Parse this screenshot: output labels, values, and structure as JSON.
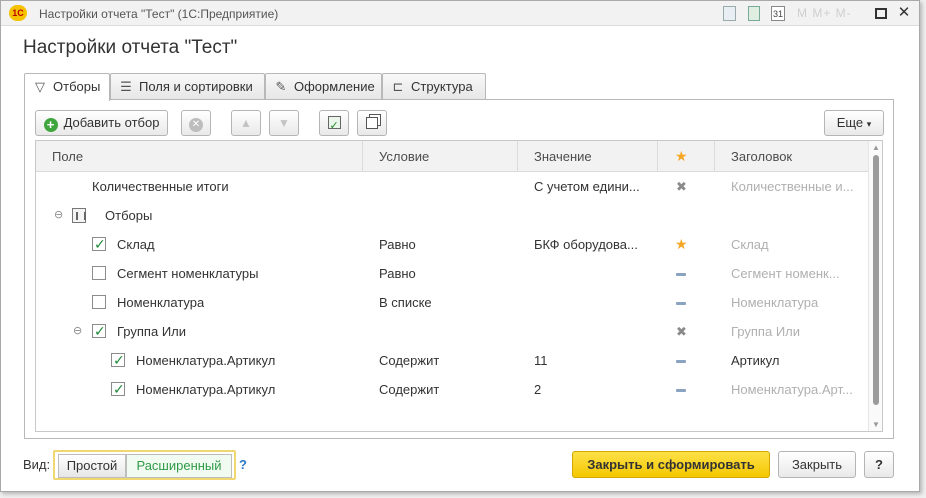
{
  "window": {
    "app_logo": "1С",
    "title": "Настройки отчета \"Тест\" (1С:Предприятие)",
    "titlebar_faint": "М М+ М-",
    "calendar_day": "31"
  },
  "form_title": "Настройки отчета \"Тест\"",
  "tabs": [
    {
      "label": "Отборы",
      "icon": "funnel-icon"
    },
    {
      "label": "Поля и сортировки",
      "icon": "list-icon"
    },
    {
      "label": "Оформление",
      "icon": "brush-icon"
    },
    {
      "label": "Структура",
      "icon": "tree-icon"
    }
  ],
  "toolbar": {
    "add_filter": "Добавить отбор",
    "more": "Еще",
    "more_arrow": "▾"
  },
  "grid": {
    "columns": [
      "Поле",
      "Условие",
      "Значение",
      "★",
      "Заголовок"
    ],
    "rows": [
      {
        "field": "Количественные итоги",
        "condition": "",
        "value": "С учетом едини...",
        "mark": "✖",
        "caption": "Количественные и..."
      },
      {
        "field": "Отборы",
        "condition": "",
        "value": "",
        "mark": "",
        "caption": "",
        "expander": "⊖"
      },
      {
        "field": "Склад",
        "condition": "Равно",
        "value": "БКФ оборудова...",
        "mark": "★",
        "caption": "Склад",
        "checked": true
      },
      {
        "field": "Сегмент номенклатуры",
        "condition": "Равно",
        "value": "",
        "mark": "—",
        "caption": "Сегмент номенк...",
        "checked": false
      },
      {
        "field": "Номенклатура",
        "condition": "В списке",
        "value": "",
        "mark": "—",
        "caption": "Номенклатура",
        "checked": false
      },
      {
        "field": "Группа Или",
        "condition": "",
        "value": "",
        "mark": "✖",
        "caption": "Группа Или",
        "checked": true,
        "expander": "⊖"
      },
      {
        "field": "Номенклатура.Артикул",
        "condition": "Содержит",
        "value": "11",
        "mark": "—",
        "caption": "Артикул",
        "checked": true
      },
      {
        "field": "Номенклатура.Артикул",
        "condition": "Содержит",
        "value": "2",
        "mark": "—",
        "caption": "Номенклатура.Арт...",
        "checked": true
      }
    ]
  },
  "footer": {
    "view_label": "Вид:",
    "view_simple": "Простой",
    "view_extended": "Расширенный",
    "view_help": "?",
    "close_and_generate": "Закрыть и сформировать",
    "close": "Закрыть",
    "help": "?"
  },
  "colors": {
    "accent_yellow": "#f4c800",
    "check_green": "#1f8a3a",
    "star_orange": "#f5a623"
  }
}
